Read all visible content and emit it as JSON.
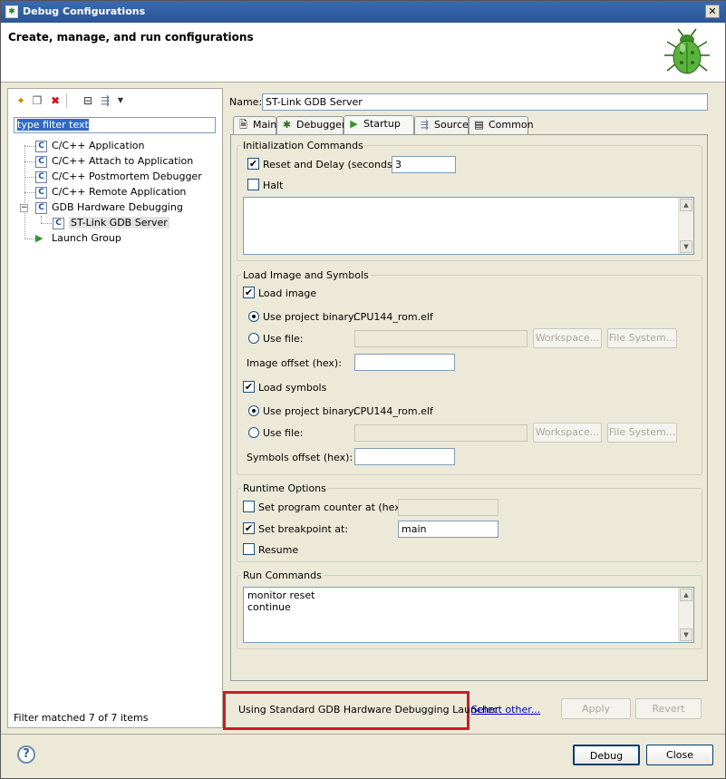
{
  "window": {
    "title": "Debug Configurations"
  },
  "header": {
    "title": "Create, manage, and run configurations"
  },
  "left": {
    "filter_value": "type filter text",
    "tree": [
      {
        "label": "C/C++ Application",
        "icon": "c-config-icon"
      },
      {
        "label": "C/C++ Attach to Application",
        "icon": "c-config-icon"
      },
      {
        "label": "C/C++ Postmortem Debugger",
        "icon": "c-config-icon"
      },
      {
        "label": "C/C++ Remote Application",
        "icon": "c-config-icon"
      },
      {
        "label": "GDB Hardware Debugging",
        "icon": "c-config-icon",
        "expanded": true
      },
      {
        "label": "ST-Link GDB Server",
        "icon": "c-config-icon",
        "selected": true
      },
      {
        "label": "Launch Group",
        "icon": "launch-group-icon"
      }
    ],
    "status": "Filter matched 7 of 7 items"
  },
  "config": {
    "name_label": "Name:",
    "name_value": "ST-Link GDB Server",
    "tabs": [
      {
        "label": "Main"
      },
      {
        "label": "Debugger"
      },
      {
        "label": "Startup",
        "active": true
      },
      {
        "label": "Source"
      },
      {
        "label": "Common"
      }
    ]
  },
  "init": {
    "title": "Initialization Commands",
    "reset_label": "Reset and Delay (seconds):",
    "reset_checked": true,
    "reset_value": "3",
    "halt_label": "Halt",
    "halt_checked": false
  },
  "load": {
    "title": "Load Image and Symbols",
    "load_image_label": "Load image",
    "use_project_binary_label": "Use project binary:",
    "image_binary": "CPU144_rom.elf",
    "use_file_label": "Use file:",
    "workspace_label": "Workspace...",
    "filesystem_label": "File System...",
    "image_offset_label": "Image offset (hex):",
    "load_symbols_label": "Load symbols",
    "symbols_binary": "CPU144_rom.elf",
    "symbols_offset_label": "Symbols offset (hex):"
  },
  "runtime": {
    "title": "Runtime Options",
    "set_pc_label": "Set program counter at (hex):",
    "set_bp_label": "Set breakpoint at:",
    "bp_value": "main",
    "resume_label": "Resume"
  },
  "run": {
    "title": "Run Commands",
    "line1": "monitor reset",
    "line2": "continue"
  },
  "footer": {
    "launcher_text": "Using Standard GDB Hardware Debugging Launcher",
    "select_other": "Select other...",
    "apply": "Apply",
    "revert": "Revert",
    "debug": "Debug",
    "close": "Close",
    "highlight_color": "#cc1a2a"
  }
}
